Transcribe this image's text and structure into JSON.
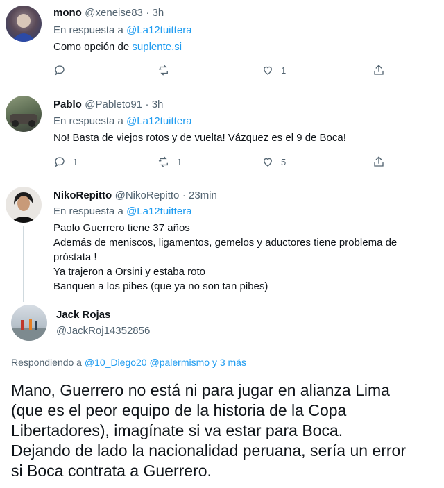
{
  "tweets": [
    {
      "name": "mono",
      "handle": "@xeneise83",
      "time": "· 3h",
      "reply_prefix": "En respuesta a",
      "reply_mention": "@La12tuittera",
      "text_plain": "Como opción de ",
      "text_link": "suplente.si",
      "actions": {
        "reply": "",
        "retweet": "",
        "like": "1"
      }
    },
    {
      "name": "Pablo",
      "handle": "@Pableto91",
      "time": "· 3h",
      "reply_prefix": "En respuesta a",
      "reply_mention": "@La12tuittera",
      "text": "No! Basta de viejos rotos y de vuelta! Vázquez es el 9 de Boca!",
      "actions": {
        "reply": "1",
        "retweet": "1",
        "like": "5"
      }
    },
    {
      "name": "NikoRepitto",
      "handle": "@NikoRepitto",
      "time": "· 23min",
      "reply_prefix": "En respuesta a",
      "reply_mention": "@La12tuittera",
      "lines": [
        "Paolo Guerrero tiene 37 años",
        "Además de meniscos, ligamentos, gemelos y aductores tiene problema de",
        "próstata !",
        "Ya trajeron a Orsini y estaba roto",
        "Banquen a los pibes (que ya no son tan pibes)"
      ]
    }
  ],
  "detail": {
    "name": "Jack Rojas",
    "handle": "@JackRoj14352856",
    "replying_prefix": "Respondiendo a",
    "replying_mentions": "@10_Diego20 @palermismo y 3 más",
    "lines": [
      "Mano, Guerrero no está ni para jugar en alianza Lima",
      "(que es el peor equipo de la historia de la Copa",
      "Libertadores), imagínate si va estar para Boca.",
      "Dejando de lado la nacionalidad peruana, sería un error",
      "si Boca contrata a Guerrero."
    ]
  },
  "colors": {
    "accent": "#1d9bf0",
    "secondary_text": "#536471",
    "text": "#0f1419"
  },
  "icons": [
    "reply-icon",
    "retweet-icon",
    "like-icon",
    "share-icon"
  ]
}
